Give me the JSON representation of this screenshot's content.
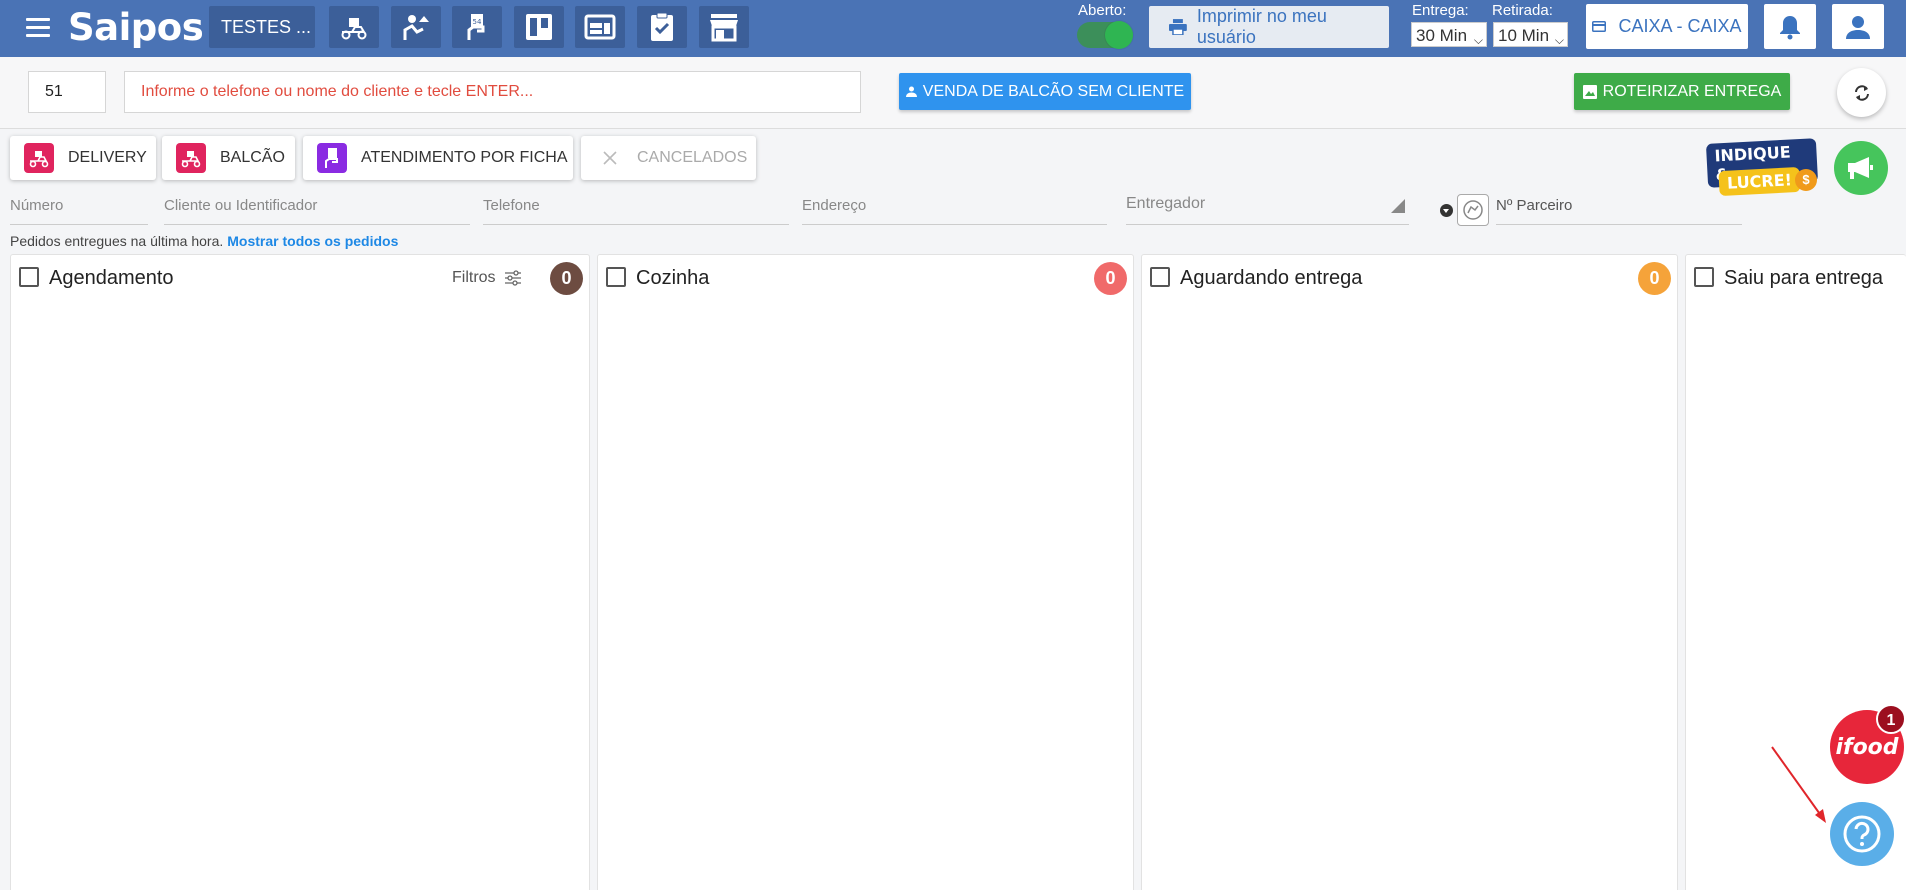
{
  "header": {
    "brand": "Saipos",
    "store_name": "TESTES ...",
    "aberto_label": "Aberto:",
    "print_label": "Imprimir no meu usuário",
    "entrega_label": "Entrega:",
    "entrega_value": "30 Min",
    "retirada_label": "Retirada:",
    "retirada_value": "10 Min",
    "caixa_label": "CAIXA - CAIXA",
    "colors": {
      "bar": "#4a73b5",
      "item": "#3c5f99",
      "accent": "#3b73bf"
    }
  },
  "toolbar": {
    "number_value": "51",
    "client_placeholder": "Informe o telefone ou nome do cliente e tecle ENTER...",
    "balcao_button": "VENDA DE BALCÃO SEM CLIENTE",
    "roteirizar_button": "ROTEIRIZAR ENTREGA"
  },
  "filters": {
    "delivery": "DELIVERY",
    "balcao": "BALCÃO",
    "ficha": "ATENDIMENTO POR FICHA",
    "cancelados": "CANCELADOS"
  },
  "promo": {
    "line1": "INDIQUE &",
    "line2": "LUCRE!",
    "coin": "$"
  },
  "search": {
    "numero": "Número",
    "cliente": "Cliente ou Identificador",
    "telefone": "Telefone",
    "endereco": "Endereço",
    "entregador": "Entregador",
    "parceiro": "Nº Parceiro"
  },
  "info": {
    "text": "Pedidos entregues na última hora.",
    "link": "Mostrar todos os pedidos"
  },
  "columns": [
    {
      "title": "Agendamento",
      "count": "0",
      "color": "#6d4c41",
      "filtros": "Filtros"
    },
    {
      "title": "Cozinha",
      "count": "0",
      "color": "#f06a6a"
    },
    {
      "title": "Aguardando entrega",
      "count": "0",
      "color": "#f5a33a"
    },
    {
      "title": "Saiu para entrega"
    }
  ],
  "floating": {
    "ifood_label": "ifood",
    "ifood_badge": "1"
  }
}
